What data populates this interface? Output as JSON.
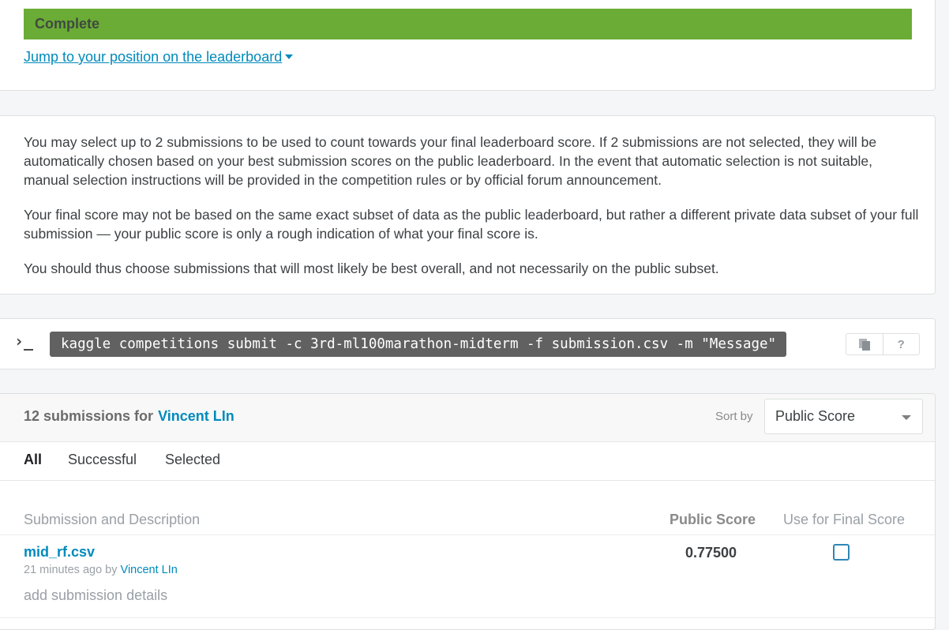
{
  "status": {
    "complete_label": "Complete",
    "jump_link": "Jump to your position on the leaderboard",
    "complete_color": "#6aac35"
  },
  "info": {
    "p1": "You may select up to 2 submissions to be used to count towards your final leaderboard score. If 2 submissions are not selected, they will be automatically chosen based on your best submission scores on the public leaderboard. In the event that automatic selection is not suitable, manual selection instructions will be provided in the competition rules or by official forum announcement.",
    "p2": "Your final score may not be based on the same exact subset of data as the public leaderboard, but rather a different private data subset of your full submission — your public score is only a rough indication of what your final score is.",
    "p3": "You should thus choose submissions that will most likely be best overall, and not necessarily on the public subset."
  },
  "command": {
    "prompt": "›_",
    "text": "kaggle competitions submit -c 3rd-ml100marathon-midterm -f submission.csv -m \"Message\"",
    "copy_icon": "copy-icon",
    "help_label": "?"
  },
  "submissions": {
    "count_text": "12 submissions for",
    "user": "Vincent LIn",
    "sort_label": "Sort by",
    "sort_value": "Public Score",
    "tabs": [
      {
        "label": "All",
        "active": true
      },
      {
        "label": "Successful",
        "active": false
      },
      {
        "label": "Selected",
        "active": false
      }
    ],
    "columns": {
      "description": "Submission and Description",
      "public_score": "Public Score",
      "final": "Use for Final Score"
    },
    "rows": [
      {
        "name": "mid_rf.csv",
        "time": "21 minutes ago by",
        "user": "Vincent LIn",
        "details": "add submission details",
        "score": "0.77500",
        "selected": false
      }
    ]
  },
  "accent_color": "#008abc"
}
